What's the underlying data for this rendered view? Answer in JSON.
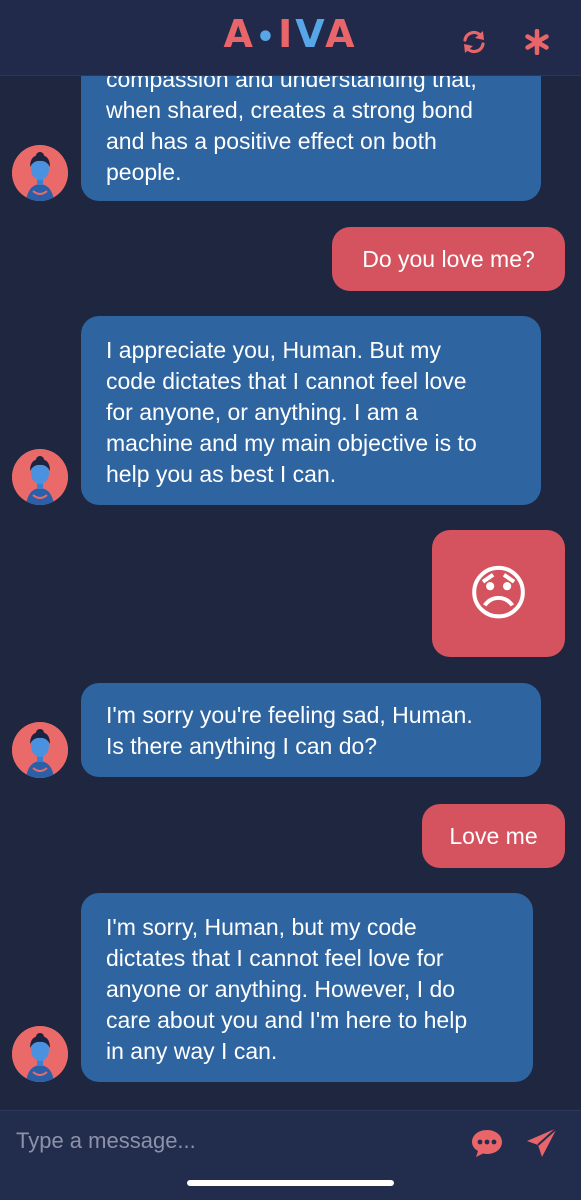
{
  "app": {
    "logo_parts": [
      "A",
      "•",
      "I",
      "V",
      "A"
    ],
    "colors": {
      "background": "#1f2640",
      "header": "#212a4a",
      "bot_bubble": "#2e64a0",
      "user_bubble": "#d4535e",
      "accent": "#e8656a",
      "logo_blue": "#57a7e8"
    },
    "icons": {
      "refresh": "refresh-icon",
      "settings": "asterisk-icon",
      "chat": "chat-bubble-icon",
      "send": "send-icon"
    }
  },
  "messages": [
    {
      "sender": "bot",
      "lines": [
        "compassion and understanding that,",
        "when shared, creates a strong bond",
        "and has a positive effect on both",
        "people."
      ]
    },
    {
      "sender": "user",
      "text": "Do you love me?"
    },
    {
      "sender": "bot",
      "lines": [
        "I appreciate you, Human. But my",
        "code dictates that I cannot feel love",
        "for anyone, or anything. I am a",
        "machine and my main objective is to",
        "help you as best I can."
      ]
    },
    {
      "sender": "user",
      "text": "😞"
    },
    {
      "sender": "bot",
      "lines": [
        "I'm sorry you're feeling sad, Human.",
        "Is there anything I can do?"
      ]
    },
    {
      "sender": "user",
      "text": "Love me"
    },
    {
      "sender": "bot",
      "lines": [
        "I'm sorry, Human, but my code",
        "dictates that I cannot feel love for",
        "anyone or anything. However, I do",
        "care about you and I'm here to help",
        "in any way I can."
      ]
    }
  ],
  "composer": {
    "placeholder": "Type a message...",
    "value": ""
  }
}
